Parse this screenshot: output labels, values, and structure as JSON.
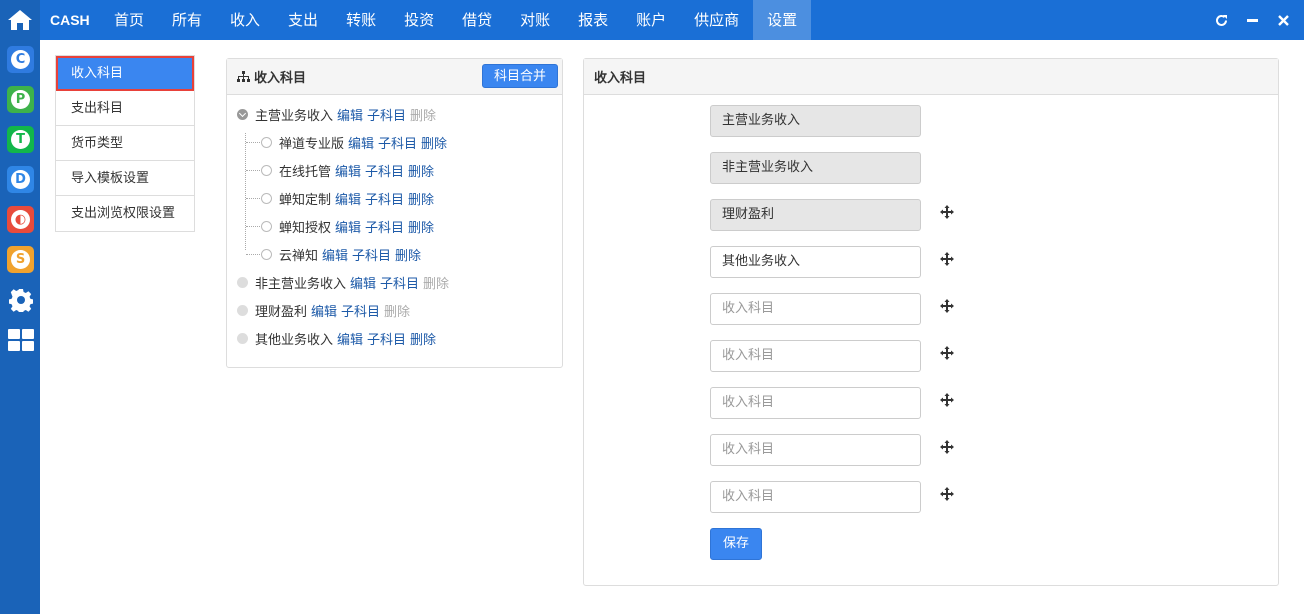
{
  "brand": "CASH",
  "nav": [
    "首页",
    "所有",
    "收入",
    "支出",
    "转账",
    "投资",
    "借贷",
    "对账",
    "报表",
    "账户",
    "供应商",
    "设置"
  ],
  "nav_active_index": 11,
  "dock_apps": [
    {
      "letter": "C",
      "color": "#2f7be0"
    },
    {
      "letter": "P",
      "color": "#3db24a"
    },
    {
      "letter": "T",
      "color": "#12b64a"
    },
    {
      "letter": "D",
      "color": "#2f86e6"
    },
    {
      "letter": "◐",
      "color": "#e84b3c"
    },
    {
      "letter": "S",
      "color": "#f0a22e"
    }
  ],
  "menu": [
    "收入科目",
    "支出科目",
    "货币类型",
    "导入模板设置",
    "支出浏览权限设置"
  ],
  "menu_active_index": 0,
  "tree_panel": {
    "title": "收入科目",
    "merge_button": "科目合并"
  },
  "tree": {
    "edit": "编辑",
    "child": "子科目",
    "delete": "删除",
    "roots": [
      {
        "label": "主营业务收入",
        "expanded": true,
        "delete_enabled": false
      },
      {
        "label": "非主营业务收入",
        "expanded": false,
        "delete_enabled": false
      },
      {
        "label": "理财盈利",
        "expanded": false,
        "delete_enabled": false
      },
      {
        "label": "其他业务收入",
        "expanded": false,
        "delete_enabled": true
      }
    ],
    "children": [
      "禅道专业版",
      "在线托管",
      "蝉知定制",
      "蝉知授权",
      "云禅知"
    ]
  },
  "form_panel": {
    "title": "收入科目",
    "placeholder": "收入科目",
    "fields": [
      {
        "value": "主营业务收入",
        "locked": true
      },
      {
        "value": "非主营业务收入",
        "locked": true
      },
      {
        "value": "理财盈利",
        "locked": true
      },
      {
        "value": "其他业务收入",
        "locked": false
      },
      {
        "value": "",
        "locked": false
      },
      {
        "value": "",
        "locked": false
      },
      {
        "value": "",
        "locked": false
      },
      {
        "value": "",
        "locked": false
      },
      {
        "value": "",
        "locked": false
      }
    ],
    "save_button": "保存"
  }
}
